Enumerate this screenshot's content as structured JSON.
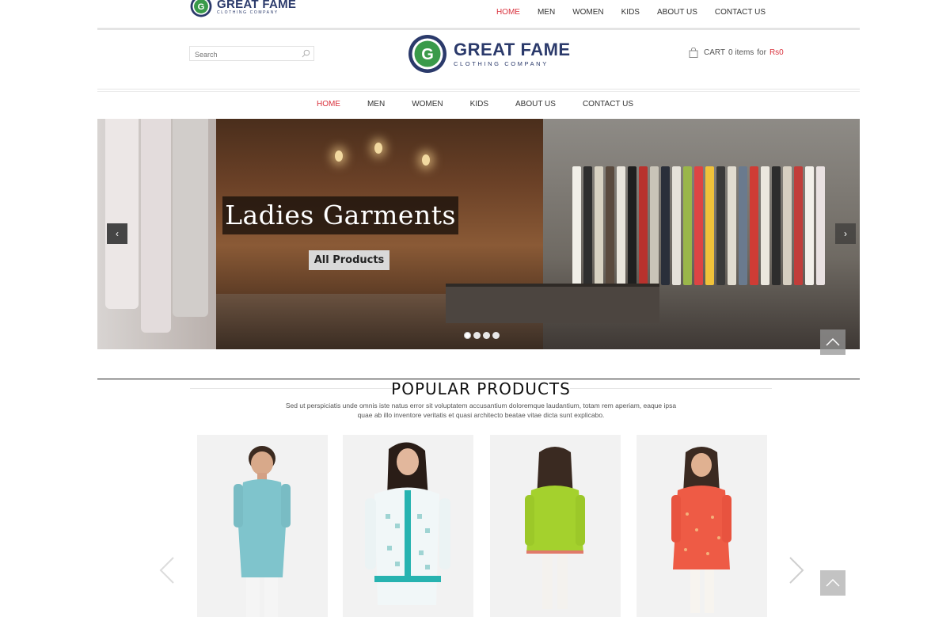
{
  "brand": {
    "name": "GREAT FAME",
    "tagline": "CLOTHING COMPANY"
  },
  "top_nav": [
    {
      "label": "HOME",
      "active": true
    },
    {
      "label": "MEN",
      "active": false
    },
    {
      "label": "WOMEN",
      "active": false
    },
    {
      "label": "KIDS",
      "active": false
    },
    {
      "label": "ABOUT US",
      "active": false
    },
    {
      "label": "CONTACT US",
      "active": false
    }
  ],
  "search": {
    "placeholder": "Search",
    "value": "",
    "icon": "search-icon"
  },
  "cart": {
    "icon": "shopping-bag-icon",
    "label": "CART",
    "items": "0 items",
    "for": "for",
    "amount": "Rs0"
  },
  "main_nav": [
    {
      "label": "HOME",
      "active": true
    },
    {
      "label": "MEN",
      "active": false
    },
    {
      "label": "WOMEN",
      "active": false
    },
    {
      "label": "KIDS",
      "active": false
    },
    {
      "label": "ABOUT US",
      "active": false
    },
    {
      "label": "CONTACT US",
      "active": false
    }
  ],
  "slider": {
    "title": "Ladies Garments",
    "button": "All Products",
    "prev": "‹",
    "next": "›",
    "slides": 4,
    "active_slide": 1
  },
  "popular": {
    "title": "POPULAR PRODUCTS",
    "description": "Sed ut perspiciatis unde omnis iste natus error sit voluptatem accusantium doloremque laudantium, totam rem aperiam, eaque ipsa quae ab illo inventore veritatis et quasi architecto beatae vitae dicta sunt explicabo.",
    "products": [
      {
        "name": "boy-kurta-turquoise"
      },
      {
        "name": "women-kurta-white-printed"
      },
      {
        "name": "girl-kurta-lime"
      },
      {
        "name": "girl-kurta-coral"
      }
    ]
  },
  "colors": {
    "accent": "#d9323d",
    "brand": "#2b3a6b"
  }
}
